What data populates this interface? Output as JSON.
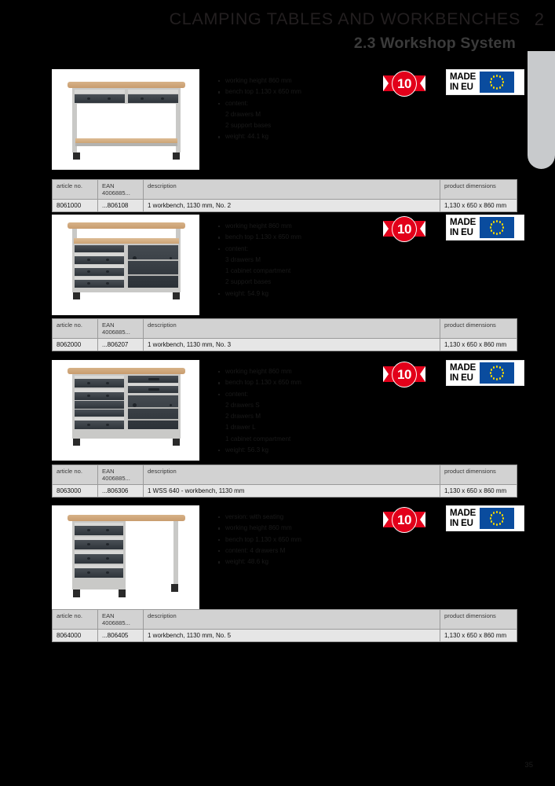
{
  "header": {
    "title": "CLAMPING TABLES AND WORKBENCHES",
    "chapter": "2",
    "subtitle": "2.3 Workshop System"
  },
  "page_number": "35",
  "table_headers": {
    "article": "article no.",
    "ean": "EAN",
    "ean_prefix": "4006885...",
    "description": "description",
    "dimensions": "product dimensions"
  },
  "badges": {
    "warranty_years": "10",
    "made_line1": "MADE",
    "made_line2": "IN EU"
  },
  "products": [
    {
      "specs": [
        "working height 860 mm",
        "bench top 1.130 x 650 mm",
        "content:"
      ],
      "sub_specs": [
        "2 drawers M",
        "2 support bases"
      ],
      "weight": "weight: 44.1 kg",
      "row": {
        "article": "8061000",
        "ean": "...806108",
        "description": "1 workbench, 1130 mm, No. 2",
        "dimensions": "1,130 x 650 x 860 mm"
      }
    },
    {
      "specs": [
        "working height 860 mm",
        "bench top 1.130 x 650 mm",
        "content:"
      ],
      "sub_specs": [
        "3 drawers M",
        "1 cabinet compartment",
        "2 support bases"
      ],
      "weight": "weight: 54.9 kg",
      "row": {
        "article": "8062000",
        "ean": "...806207",
        "description": "1 workbench, 1130 mm, No. 3",
        "dimensions": "1,130 x 650 x 860 mm"
      }
    },
    {
      "specs": [
        "working height 860 mm",
        "bench top 1.130 x 650 mm",
        "content:"
      ],
      "sub_specs": [
        "2 drawers S",
        "2 drawers M",
        "1 drawer L",
        "1 cabinet compartment"
      ],
      "weight": "weight: 56.3 kg",
      "row": {
        "article": "8063000",
        "ean": "...806306",
        "description": "1 WSS 640 - workbench, 1130 mm",
        "dimensions": "1,130 x 650 x 860 mm"
      }
    },
    {
      "specs": [
        "version: with seating",
        "working height 860 mm",
        "bench top 1.130 x 650 mm",
        "content: 4 drawers M"
      ],
      "sub_specs": [],
      "weight": "weight: 48.6 kg",
      "row": {
        "article": "8064000",
        "ean": "...806405",
        "description": "1 workbench, 1130 mm, No. 5",
        "dimensions": "1,130 x 650 x 860 mm"
      }
    }
  ]
}
